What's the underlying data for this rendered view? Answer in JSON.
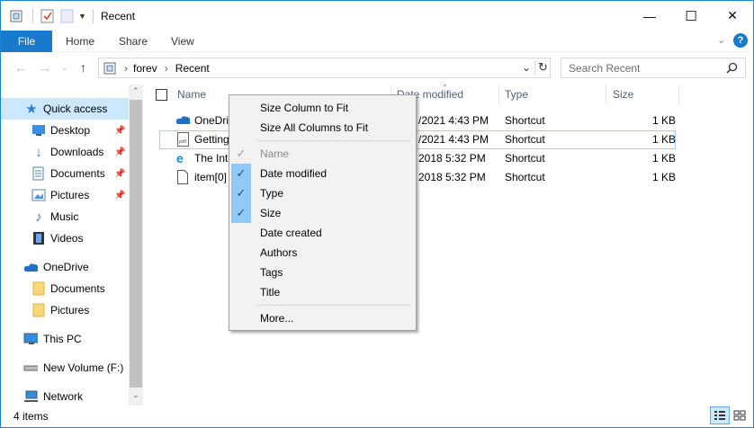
{
  "window": {
    "title": "Recent",
    "controls": {
      "minimize": "—",
      "maximize": "☐",
      "close": "✕"
    }
  },
  "ribbon": {
    "tabs": [
      "File",
      "Home",
      "Share",
      "View"
    ],
    "expand_glyph": "⌄",
    "help_glyph": "?"
  },
  "address": {
    "crumbs": [
      "forev",
      "Recent"
    ],
    "separator": "›",
    "search_placeholder": "Search Recent"
  },
  "sidebar": {
    "items": [
      {
        "label": "Quick access",
        "icon": "star-icon",
        "pinned": false,
        "selected": true
      },
      {
        "label": "Desktop",
        "icon": "desktop-icon",
        "pinned": true
      },
      {
        "label": "Downloads",
        "icon": "download-icon",
        "pinned": true
      },
      {
        "label": "Documents",
        "icon": "documents-icon",
        "pinned": true
      },
      {
        "label": "Pictures",
        "icon": "pictures-icon",
        "pinned": true
      },
      {
        "label": "Music",
        "icon": "music-icon",
        "pinned": false
      },
      {
        "label": "Videos",
        "icon": "videos-icon",
        "pinned": false
      },
      {
        "label": "OneDrive",
        "icon": "onedrive-icon",
        "pinned": false
      },
      {
        "label": "Documents",
        "icon": "folder-icon",
        "pinned": false
      },
      {
        "label": "Pictures",
        "icon": "folder-icon",
        "pinned": false
      },
      {
        "label": "This PC",
        "icon": "pc-icon",
        "pinned": false
      },
      {
        "label": "New Volume (F:)",
        "icon": "drive-icon",
        "pinned": false
      },
      {
        "label": "Network",
        "icon": "network-icon",
        "pinned": false
      }
    ]
  },
  "columns": {
    "name": "Name",
    "date_modified": "Date modified",
    "type": "Type",
    "size": "Size"
  },
  "files": [
    {
      "name": "OneDriv",
      "date": "/2021 4:43 PM",
      "type": "Shortcut",
      "size": "1 KB",
      "icon": "onedrive-icon"
    },
    {
      "name": "Getting",
      "date": "/2021 4:43 PM",
      "type": "Shortcut",
      "size": "1 KB",
      "icon": "pdf-icon",
      "selected": true
    },
    {
      "name": "The Inte",
      "date": "2018 5:32 PM",
      "type": "Shortcut",
      "size": "1 KB",
      "icon": "ie-icon"
    },
    {
      "name": "item[0]",
      "date": "2018 5:32 PM",
      "type": "Shortcut",
      "size": "1 KB",
      "icon": "file-icon"
    }
  ],
  "context_menu": {
    "items": [
      {
        "label": "Size Column to Fit",
        "check": "none"
      },
      {
        "label": "Size All Columns to Fit",
        "check": "none"
      },
      {
        "label": "Name",
        "check": "disabled"
      },
      {
        "label": "Date modified",
        "check": "checked"
      },
      {
        "label": "Type",
        "check": "checked"
      },
      {
        "label": "Size",
        "check": "checked"
      },
      {
        "label": "Date created",
        "check": "none"
      },
      {
        "label": "Authors",
        "check": "none"
      },
      {
        "label": "Tags",
        "check": "none"
      },
      {
        "label": "Title",
        "check": "none"
      },
      {
        "label": "More...",
        "check": "none"
      }
    ],
    "check_glyph": "✓"
  },
  "status": {
    "item_count": "4 items"
  },
  "colors": {
    "accent": "#1979ca",
    "selection": "#cce8ff",
    "menu_check": "#91c9f7"
  }
}
